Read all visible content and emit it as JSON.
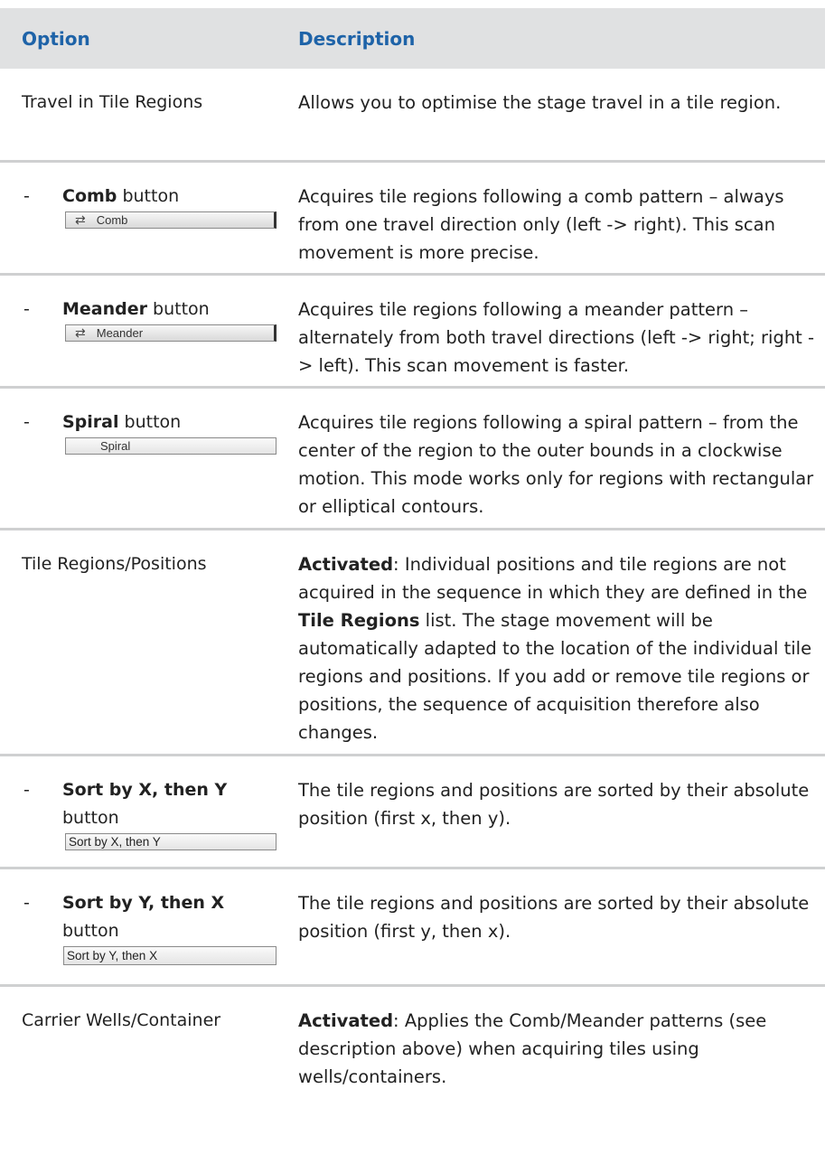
{
  "header": {
    "option": "Option",
    "description": "Description"
  },
  "rows": [
    {
      "option": "Travel in Tile Regions",
      "description": "Allows you to optimise the stage travel in a tile region."
    },
    {
      "dash": "-",
      "option_bold": "Comb",
      "option_rest": " button",
      "button": {
        "label": "Comb",
        "icon": "comb-arrows-icon"
      },
      "description": "Acquires tile regions following a comb pattern – always from one travel direction only (left -> right). This scan movement is more precise."
    },
    {
      "dash": "-",
      "option_bold": "Meander",
      "option_rest": " button",
      "button": {
        "label": "Meander",
        "icon": "meander-arrows-icon"
      },
      "description": "Acquires tile regions following a meander pattern – alternately from both travel directions (left -> right; right -> left). This scan movement is faster."
    },
    {
      "dash": "-",
      "option_bold": "Spiral",
      "option_rest": " button",
      "button": {
        "label": "Spiral"
      },
      "description": "Acquires tile regions following a spiral pattern – from the center of the region to the outer bounds in a clockwise motion. This mode works only for regions with rectangular or elliptical contours."
    },
    {
      "option": "Tile Regions/Positions",
      "desc_bold1": "Activated",
      "desc_part1": ": Individual positions and tile regions are not acquired in the sequence in which they are defined in the ",
      "desc_bold2": "Tile Regions",
      "desc_part2": " list. The stage movement will be automatically adapted to the location of the individual tile regions and positions. If you add or remove tile regions or positions, the sequence of acquisition therefore also changes."
    },
    {
      "dash": "-",
      "option_bold": "Sort by X, then Y",
      "option_rest": "button",
      "button": {
        "label": "Sort by X, then Y"
      },
      "description": "The tile regions and positions are sorted by their absolute position (first x, then y)."
    },
    {
      "dash": "-",
      "option_bold": "Sort by Y, then X",
      "option_rest": "button",
      "button": {
        "label": "Sort by Y, then X"
      },
      "description": "The tile regions and positions are sorted by their absolute position (first y, then x)."
    },
    {
      "option": "Carrier Wells/Container",
      "desc_bold1": "Activated",
      "desc_part1": ": Applies the Comb/Meander patterns (see description above) when acquiring tiles using wells/containers."
    }
  ]
}
